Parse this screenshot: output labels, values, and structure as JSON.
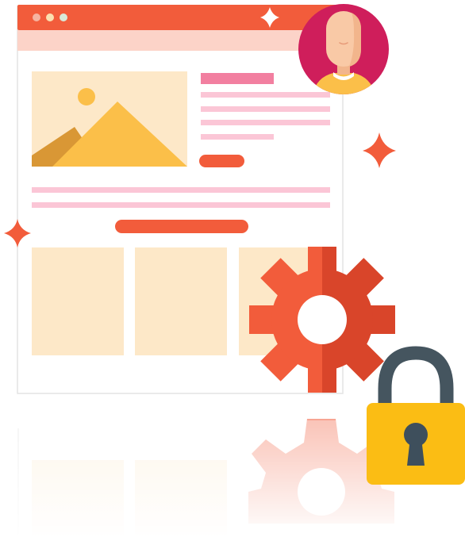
{
  "colors": {
    "titlebar": "#f25c3b",
    "subbar": "#fcd3c8",
    "dot_a": "#f6b3a0",
    "dot_b": "#fbe0b0",
    "dot_c": "#d8ead9",
    "frame_bg": "#ffffff",
    "frame_border": "#e4e4e4",
    "image_panel": "#fde8c8",
    "mountain_main": "#fbbf49",
    "mountain_shadow": "#d99735",
    "sun": "#fbbf49",
    "heading_bar": "#f27fa0",
    "text_line": "#fbc6d6",
    "button": "#f25c3b",
    "card": "#fde8c8",
    "sparkle_light": "#ffffff",
    "sparkle": "#f25c3b",
    "avatar_bg": "#cf1e5b",
    "skin": "#f9c9a6",
    "skin_shadow": "#f2b58c",
    "shirt": "#fbbf49",
    "collar": "#ffffff",
    "gear_light": "#f25c3b",
    "gear_dark": "#d9452a",
    "lock_shackle": "#45555f",
    "lock_body": "#fbbd14",
    "keyhole": "#3e4f5c"
  },
  "icons": {
    "window": "browser-window-icon",
    "image": "image-placeholder-icon",
    "avatar": "user-avatar-icon",
    "gear": "gear-icon",
    "lock": "padlock-icon",
    "sparkle": "sparkle-icon"
  }
}
